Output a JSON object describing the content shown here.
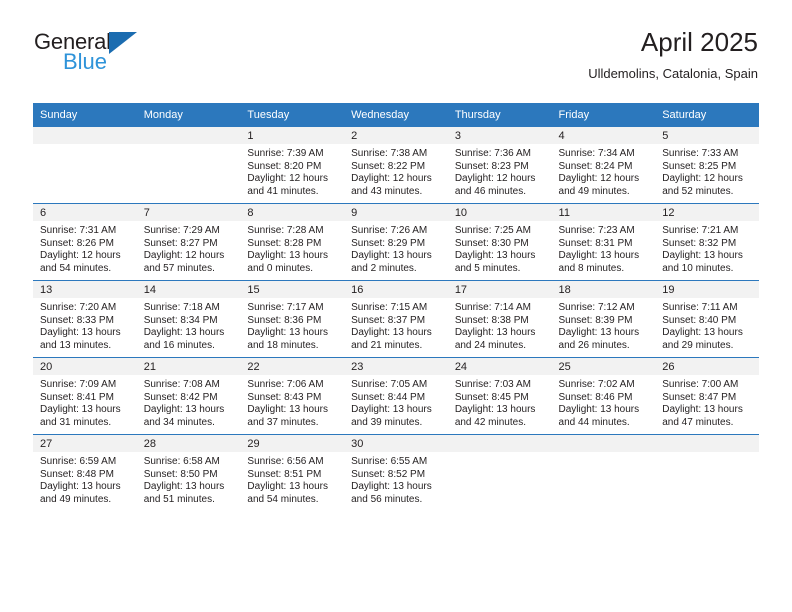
{
  "brand": {
    "name_part1": "General",
    "name_part2": "Blue",
    "logo_icon": "triangle-logo-icon"
  },
  "header": {
    "title": "April 2025",
    "subtitle": "Ulldemolins, Catalonia, Spain"
  },
  "colors": {
    "header_blue": "#2c78bd",
    "brand_blue": "#2e93d9",
    "logo_blue": "#1b6cb0",
    "daynum_band": "#f2f2f2",
    "text": "#231f20"
  },
  "weekdays": [
    "Sunday",
    "Monday",
    "Tuesday",
    "Wednesday",
    "Thursday",
    "Friday",
    "Saturday"
  ],
  "weeks": [
    [
      {
        "day": "",
        "lines": []
      },
      {
        "day": "",
        "lines": []
      },
      {
        "day": "1",
        "lines": [
          "Sunrise: 7:39 AM",
          "Sunset: 8:20 PM",
          "Daylight: 12 hours",
          "and 41 minutes."
        ]
      },
      {
        "day": "2",
        "lines": [
          "Sunrise: 7:38 AM",
          "Sunset: 8:22 PM",
          "Daylight: 12 hours",
          "and 43 minutes."
        ]
      },
      {
        "day": "3",
        "lines": [
          "Sunrise: 7:36 AM",
          "Sunset: 8:23 PM",
          "Daylight: 12 hours",
          "and 46 minutes."
        ]
      },
      {
        "day": "4",
        "lines": [
          "Sunrise: 7:34 AM",
          "Sunset: 8:24 PM",
          "Daylight: 12 hours",
          "and 49 minutes."
        ]
      },
      {
        "day": "5",
        "lines": [
          "Sunrise: 7:33 AM",
          "Sunset: 8:25 PM",
          "Daylight: 12 hours",
          "and 52 minutes."
        ]
      }
    ],
    [
      {
        "day": "6",
        "lines": [
          "Sunrise: 7:31 AM",
          "Sunset: 8:26 PM",
          "Daylight: 12 hours",
          "and 54 minutes."
        ]
      },
      {
        "day": "7",
        "lines": [
          "Sunrise: 7:29 AM",
          "Sunset: 8:27 PM",
          "Daylight: 12 hours",
          "and 57 minutes."
        ]
      },
      {
        "day": "8",
        "lines": [
          "Sunrise: 7:28 AM",
          "Sunset: 8:28 PM",
          "Daylight: 13 hours",
          "and 0 minutes."
        ]
      },
      {
        "day": "9",
        "lines": [
          "Sunrise: 7:26 AM",
          "Sunset: 8:29 PM",
          "Daylight: 13 hours",
          "and 2 minutes."
        ]
      },
      {
        "day": "10",
        "lines": [
          "Sunrise: 7:25 AM",
          "Sunset: 8:30 PM",
          "Daylight: 13 hours",
          "and 5 minutes."
        ]
      },
      {
        "day": "11",
        "lines": [
          "Sunrise: 7:23 AM",
          "Sunset: 8:31 PM",
          "Daylight: 13 hours",
          "and 8 minutes."
        ]
      },
      {
        "day": "12",
        "lines": [
          "Sunrise: 7:21 AM",
          "Sunset: 8:32 PM",
          "Daylight: 13 hours",
          "and 10 minutes."
        ]
      }
    ],
    [
      {
        "day": "13",
        "lines": [
          "Sunrise: 7:20 AM",
          "Sunset: 8:33 PM",
          "Daylight: 13 hours",
          "and 13 minutes."
        ]
      },
      {
        "day": "14",
        "lines": [
          "Sunrise: 7:18 AM",
          "Sunset: 8:34 PM",
          "Daylight: 13 hours",
          "and 16 minutes."
        ]
      },
      {
        "day": "15",
        "lines": [
          "Sunrise: 7:17 AM",
          "Sunset: 8:36 PM",
          "Daylight: 13 hours",
          "and 18 minutes."
        ]
      },
      {
        "day": "16",
        "lines": [
          "Sunrise: 7:15 AM",
          "Sunset: 8:37 PM",
          "Daylight: 13 hours",
          "and 21 minutes."
        ]
      },
      {
        "day": "17",
        "lines": [
          "Sunrise: 7:14 AM",
          "Sunset: 8:38 PM",
          "Daylight: 13 hours",
          "and 24 minutes."
        ]
      },
      {
        "day": "18",
        "lines": [
          "Sunrise: 7:12 AM",
          "Sunset: 8:39 PM",
          "Daylight: 13 hours",
          "and 26 minutes."
        ]
      },
      {
        "day": "19",
        "lines": [
          "Sunrise: 7:11 AM",
          "Sunset: 8:40 PM",
          "Daylight: 13 hours",
          "and 29 minutes."
        ]
      }
    ],
    [
      {
        "day": "20",
        "lines": [
          "Sunrise: 7:09 AM",
          "Sunset: 8:41 PM",
          "Daylight: 13 hours",
          "and 31 minutes."
        ]
      },
      {
        "day": "21",
        "lines": [
          "Sunrise: 7:08 AM",
          "Sunset: 8:42 PM",
          "Daylight: 13 hours",
          "and 34 minutes."
        ]
      },
      {
        "day": "22",
        "lines": [
          "Sunrise: 7:06 AM",
          "Sunset: 8:43 PM",
          "Daylight: 13 hours",
          "and 37 minutes."
        ]
      },
      {
        "day": "23",
        "lines": [
          "Sunrise: 7:05 AM",
          "Sunset: 8:44 PM",
          "Daylight: 13 hours",
          "and 39 minutes."
        ]
      },
      {
        "day": "24",
        "lines": [
          "Sunrise: 7:03 AM",
          "Sunset: 8:45 PM",
          "Daylight: 13 hours",
          "and 42 minutes."
        ]
      },
      {
        "day": "25",
        "lines": [
          "Sunrise: 7:02 AM",
          "Sunset: 8:46 PM",
          "Daylight: 13 hours",
          "and 44 minutes."
        ]
      },
      {
        "day": "26",
        "lines": [
          "Sunrise: 7:00 AM",
          "Sunset: 8:47 PM",
          "Daylight: 13 hours",
          "and 47 minutes."
        ]
      }
    ],
    [
      {
        "day": "27",
        "lines": [
          "Sunrise: 6:59 AM",
          "Sunset: 8:48 PM",
          "Daylight: 13 hours",
          "and 49 minutes."
        ]
      },
      {
        "day": "28",
        "lines": [
          "Sunrise: 6:58 AM",
          "Sunset: 8:50 PM",
          "Daylight: 13 hours",
          "and 51 minutes."
        ]
      },
      {
        "day": "29",
        "lines": [
          "Sunrise: 6:56 AM",
          "Sunset: 8:51 PM",
          "Daylight: 13 hours",
          "and 54 minutes."
        ]
      },
      {
        "day": "30",
        "lines": [
          "Sunrise: 6:55 AM",
          "Sunset: 8:52 PM",
          "Daylight: 13 hours",
          "and 56 minutes."
        ]
      },
      {
        "day": "",
        "lines": []
      },
      {
        "day": "",
        "lines": []
      },
      {
        "day": "",
        "lines": []
      }
    ]
  ]
}
